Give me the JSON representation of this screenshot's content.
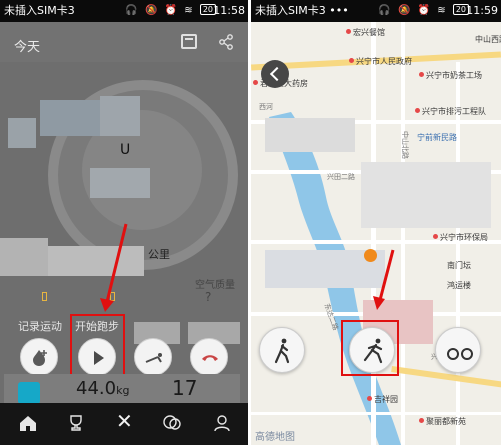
{
  "left": {
    "status": {
      "carrier": "未插入SIM卡3",
      "battery": "20",
      "time": "11:58"
    },
    "header": {
      "title": "今天"
    },
    "ring": {
      "letter": "U"
    },
    "stats": {
      "km_suffix": "公里",
      "air_label": "空气质量",
      "air_value": "?"
    },
    "actions": {
      "record_label": "记录运动",
      "start_label": "开始跑步"
    },
    "readings": {
      "weight_value": "44.0",
      "weight_unit": "kg",
      "count": "17"
    },
    "tabbar": {
      "close": "✕"
    }
  },
  "right": {
    "status": {
      "carrier": "未插入SIM卡3 •••",
      "battery": "20",
      "time": "11:59"
    },
    "map": {
      "pois": [
        "宏兴餐馆",
        "兴宁市人民政府",
        "兴宁市奶茶工场",
        "君之堂大药房",
        "兴宁市排污工程队",
        "宁前新民路",
        "兴宁市环保局",
        "南门坛",
        "鸿运楼",
        "吉祥园",
        "聚丽都新苑",
        "中山西路"
      ],
      "streets": [
        "西河",
        "兴田二路",
        "中山北路",
        "东达二路",
        "兴宁路"
      ],
      "watermark": "高德地图"
    }
  },
  "colors": {
    "highlight": "#e01010",
    "river": "#8fc6e8",
    "orange_marker": "#f08a1c"
  }
}
